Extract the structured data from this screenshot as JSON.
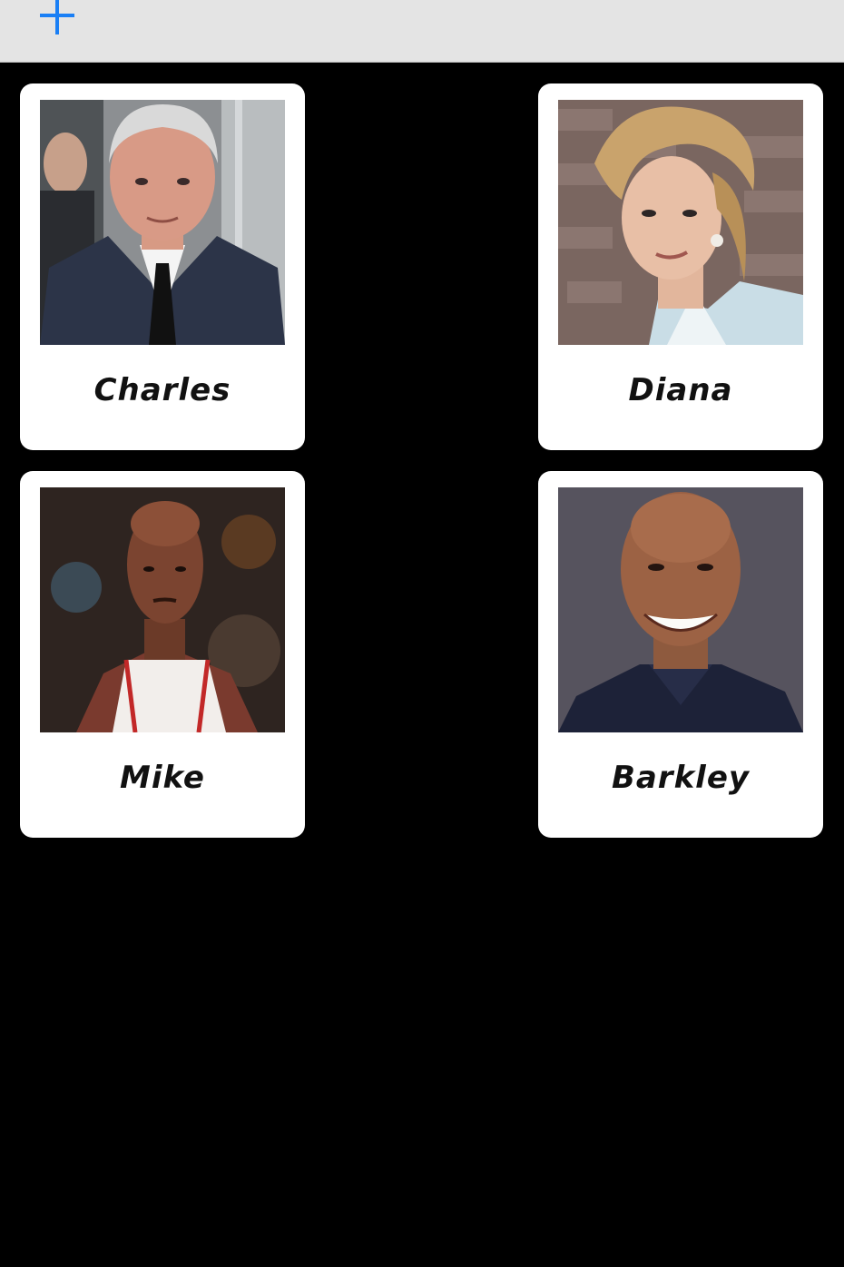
{
  "toolbar": {
    "add_icon": "plus-icon",
    "accent_color": "#1a7ff5"
  },
  "people": [
    {
      "name": "Charles"
    },
    {
      "name": "Diana"
    },
    {
      "name": "Mike"
    },
    {
      "name": "Barkley"
    }
  ]
}
